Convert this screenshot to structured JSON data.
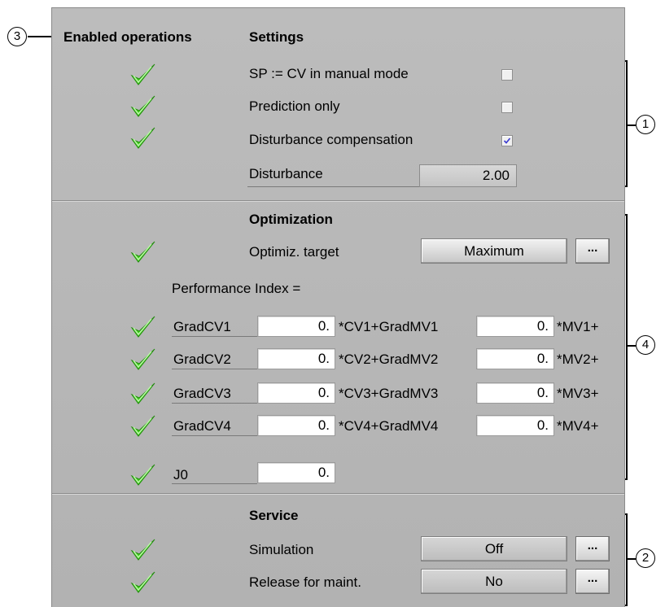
{
  "headers": {
    "enabled_operations": "Enabled operations",
    "settings": "Settings",
    "optimization": "Optimization",
    "service": "Service"
  },
  "callouts": {
    "c1": "1",
    "c2": "2",
    "c3": "3",
    "c4": "4"
  },
  "settings": {
    "sp_cv_label": "SP := CV in manual mode",
    "sp_cv_checked": false,
    "prediction_label": "Prediction only",
    "prediction_checked": false,
    "disturbance_comp_label": "Disturbance compensation",
    "disturbance_comp_checked": true,
    "disturbance_label": "Disturbance",
    "disturbance_value": "2.00"
  },
  "optimization": {
    "target_label": "Optimiz. target",
    "target_value": "Maximum",
    "more_label": "...",
    "performance_label": "Performance Index =",
    "rows": [
      {
        "grad_cv": "GradCV1",
        "cv_value": "0.",
        "cv_term": "*CV1+GradMV1",
        "mv_value": "0.",
        "mv_term": "*MV1+"
      },
      {
        "grad_cv": "GradCV2",
        "cv_value": "0.",
        "cv_term": "*CV2+GradMV2",
        "mv_value": "0.",
        "mv_term": "*MV2+"
      },
      {
        "grad_cv": "GradCV3",
        "cv_value": "0.",
        "cv_term": "*CV3+GradMV3",
        "mv_value": "0.",
        "mv_term": "*MV3+"
      },
      {
        "grad_cv": "GradCV4",
        "cv_value": "0.",
        "cv_term": "*CV4+GradMV4",
        "mv_value": "0.",
        "mv_term": "*MV4+"
      }
    ],
    "j0_label": "J0",
    "j0_value": "0."
  },
  "service": {
    "simulation_label": "Simulation",
    "simulation_value": "Off",
    "release_label": "Release for maint.",
    "release_value": "No",
    "more_label": "..."
  },
  "colors": {
    "check_green": "#3fcf1c",
    "panel_gray": "#b8b8b8"
  },
  "icons": {
    "enabled": "checkmark-icon"
  }
}
